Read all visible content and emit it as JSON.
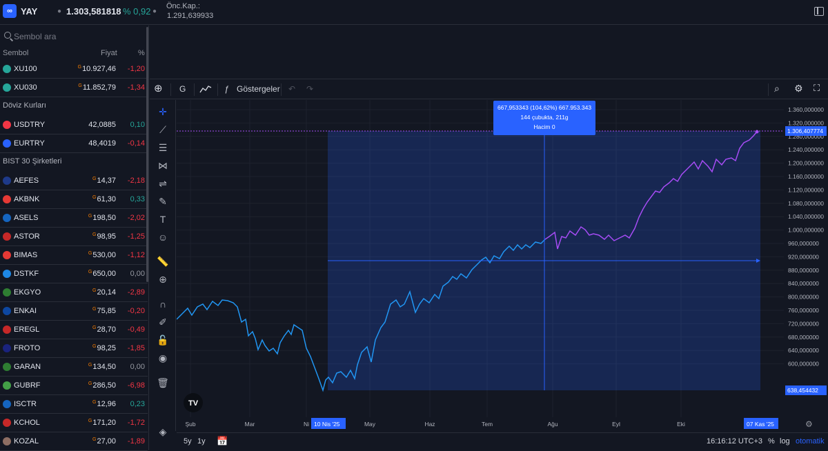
{
  "header": {
    "logo_text": "∞",
    "symbol": "YAY",
    "last_price": "1.303,581818",
    "change_pct": "% 0,92",
    "prev_close_label": "Önc.Kap.:",
    "prev_close_value": "1.291,639933"
  },
  "sidebar": {
    "search_placeholder": "Sembol ara",
    "col_symbol": "Sembol",
    "col_price": "Fiyat",
    "col_pct": "%",
    "section_fx": "Döviz Kurları",
    "section_bist": "BIST 30 Şirketleri",
    "indices": [
      {
        "symbol": "XU100",
        "price": "10.927,46",
        "pct": "-1,20",
        "dir": "down",
        "g": "G",
        "color": "#26a69a"
      },
      {
        "symbol": "XU030",
        "price": "11.852,79",
        "pct": "-1,34",
        "dir": "down",
        "g": "G",
        "color": "#26a69a"
      }
    ],
    "fx": [
      {
        "symbol": "USDTRY",
        "price": "42,0885",
        "pct": "0,10",
        "dir": "up",
        "g": "",
        "color": "#f23645"
      },
      {
        "symbol": "EURTRY",
        "price": "48,4019",
        "pct": "-0,14",
        "dir": "down",
        "g": "",
        "color": "#2962ff"
      }
    ],
    "stocks": [
      {
        "symbol": "AEFES",
        "price": "14,37",
        "pct": "-2,18",
        "dir": "down",
        "g": "G",
        "color": "#1e3a8a"
      },
      {
        "symbol": "AKBNK",
        "price": "61,30",
        "pct": "0,33",
        "dir": "up",
        "g": "G",
        "color": "#e53935"
      },
      {
        "symbol": "ASELS",
        "price": "198,50",
        "pct": "-2,02",
        "dir": "down",
        "g": "G",
        "color": "#1565c0"
      },
      {
        "symbol": "ASTOR",
        "price": "98,95",
        "pct": "-1,25",
        "dir": "down",
        "g": "G",
        "color": "#c62828"
      },
      {
        "symbol": "BIMAS",
        "price": "530,00",
        "pct": "-1,12",
        "dir": "down",
        "g": "G",
        "color": "#e53935"
      },
      {
        "symbol": "DSTKF",
        "price": "650,00",
        "pct": "0,00",
        "dir": "flat",
        "g": "G",
        "color": "#1e88e5"
      },
      {
        "symbol": "EKGYO",
        "price": "20,14",
        "pct": "-2,89",
        "dir": "down",
        "g": "G",
        "color": "#2e7d32"
      },
      {
        "symbol": "ENKAI",
        "price": "75,85",
        "pct": "-0,20",
        "dir": "down",
        "g": "G",
        "color": "#0d47a1"
      },
      {
        "symbol": "EREGL",
        "price": "28,70",
        "pct": "-0,49",
        "dir": "down",
        "g": "G",
        "color": "#c62828"
      },
      {
        "symbol": "FROTO",
        "price": "98,25",
        "pct": "-1,85",
        "dir": "down",
        "g": "G",
        "color": "#1a237e"
      },
      {
        "symbol": "GARAN",
        "price": "134,50",
        "pct": "0,00",
        "dir": "flat",
        "g": "G",
        "color": "#2e7d32"
      },
      {
        "symbol": "GUBRF",
        "price": "286,50",
        "pct": "-6,98",
        "dir": "down",
        "g": "G",
        "color": "#43a047"
      },
      {
        "symbol": "ISCTR",
        "price": "12,96",
        "pct": "0,23",
        "dir": "up",
        "g": "G",
        "color": "#1565c0"
      },
      {
        "symbol": "KCHOL",
        "price": "171,20",
        "pct": "-1,72",
        "dir": "down",
        "g": "G",
        "color": "#c62828"
      },
      {
        "symbol": "KOZAL",
        "price": "27,00",
        "pct": "-1,89",
        "dir": "down",
        "g": "G",
        "color": "#8d6e63"
      }
    ]
  },
  "toolbar": {
    "interval": "G",
    "indicators": "Göstergeler"
  },
  "chart": {
    "y_ticks": [
      "1.360,000000",
      "1.320,000000",
      "1.280,000000",
      "1.240,000000",
      "1.200,000000",
      "1.160,000000",
      "1.120,000000",
      "1.080,000000",
      "1.040,000000",
      "1.000,000000",
      "960,000000",
      "920,000000",
      "880,000000",
      "840,000000",
      "800,000000",
      "760,000000",
      "720,000000",
      "680,000000",
      "640,000000",
      "600,000000"
    ],
    "x_ticks": [
      "Şub",
      "Mar",
      "Ni",
      "May",
      "Haz",
      "Tem",
      "Ağu",
      "Eyl",
      "Eki"
    ],
    "x_start_label": "10 Nis '25",
    "x_end_label": "07 Kas '25",
    "price_label_top": "1.306,407774",
    "price_label_bottom": "638,454432",
    "measure_line1": "667,953343 (104,62%) 667.953.343",
    "measure_line2": "144 çubukta, 211g",
    "measure_line3": "Hacim 0",
    "watermark": "TV"
  },
  "bottom": {
    "range_5y": "5y",
    "range_1y": "1y",
    "clock": "16:16:12 UTC+3",
    "pct": "%",
    "log": "log",
    "auto": "otomatik"
  },
  "colors": {
    "accent": "#2962ff",
    "line_blue": "#2196f3",
    "line_purple": "#a64cf5",
    "up": "#26a69a",
    "down": "#f23645"
  }
}
